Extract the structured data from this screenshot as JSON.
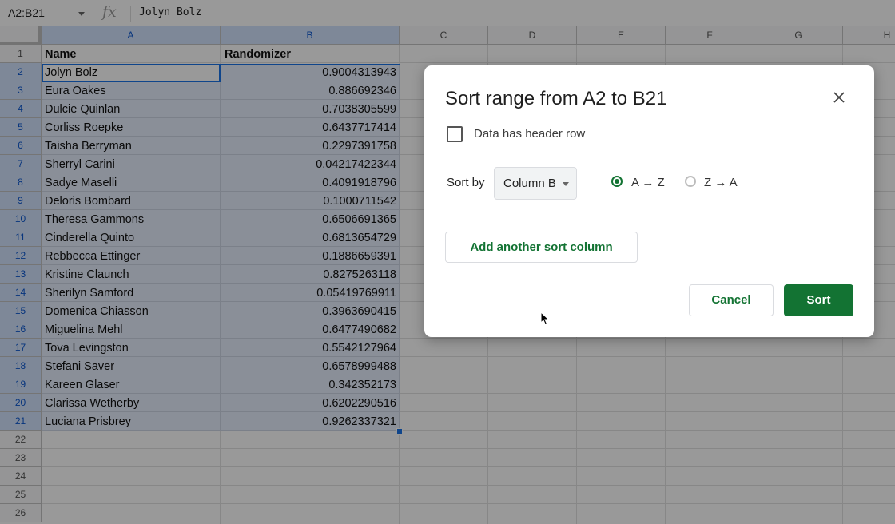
{
  "formula_bar": {
    "name_box": "A2:B21",
    "fx_label": "fx",
    "content": "Jolyn Bolz"
  },
  "sheet": {
    "columns": [
      "A",
      "B",
      "C",
      "D",
      "E",
      "F",
      "G",
      "H"
    ],
    "row_numbers": [
      "1",
      "2",
      "3",
      "4",
      "5",
      "6",
      "7",
      "8",
      "9",
      "10",
      "11",
      "12",
      "13",
      "14",
      "15",
      "16",
      "17",
      "18",
      "19",
      "20",
      "21",
      "22",
      "23",
      "24",
      "25",
      "26"
    ],
    "header": {
      "name": "Name",
      "randomizer": "Randomizer"
    },
    "rows": [
      {
        "name": "Jolyn Bolz",
        "value": "0.9004313943"
      },
      {
        "name": "Eura Oakes",
        "value": "0.886692346"
      },
      {
        "name": "Dulcie Quinlan",
        "value": "0.7038305599"
      },
      {
        "name": "Corliss Roepke",
        "value": "0.6437717414"
      },
      {
        "name": "Taisha Berryman",
        "value": "0.2297391758"
      },
      {
        "name": "Sherryl Carini",
        "value": "0.04217422344"
      },
      {
        "name": "Sadye Maselli",
        "value": "0.4091918796"
      },
      {
        "name": "Deloris Bombard",
        "value": "0.1000711542"
      },
      {
        "name": "Theresa Gammons",
        "value": "0.6506691365"
      },
      {
        "name": "Cinderella Quinto",
        "value": "0.6813654729"
      },
      {
        "name": "Rebbecca Ettinger",
        "value": "0.1886659391"
      },
      {
        "name": "Kristine Claunch",
        "value": "0.8275263118"
      },
      {
        "name": "Sherilyn Samford",
        "value": "0.05419769911"
      },
      {
        "name": "Domenica Chiasson",
        "value": "0.3963690415"
      },
      {
        "name": "Miguelina Mehl",
        "value": "0.6477490682"
      },
      {
        "name": "Tova Levingston",
        "value": "0.5542127964"
      },
      {
        "name": "Stefani Saver",
        "value": "0.6578999488"
      },
      {
        "name": "Kareen Glaser",
        "value": "0.342352173"
      },
      {
        "name": "Clarissa Wetherby",
        "value": "0.6202290516"
      },
      {
        "name": "Luciana Prisbrey",
        "value": "0.9262337321"
      }
    ]
  },
  "dialog": {
    "title": "Sort range from A2 to B21",
    "header_row_label": "Data has header row",
    "header_row_checked": false,
    "sort_by_label": "Sort by",
    "sort_by_value": "Column B",
    "option_az": "A → Z",
    "option_za": "Z → A",
    "selected_order": "A → Z",
    "add_column_label": "Add another sort column",
    "cancel_label": "Cancel",
    "sort_label": "Sort"
  },
  "colors": {
    "accent_green": "#137333",
    "selection_blue": "#1a73e8"
  }
}
